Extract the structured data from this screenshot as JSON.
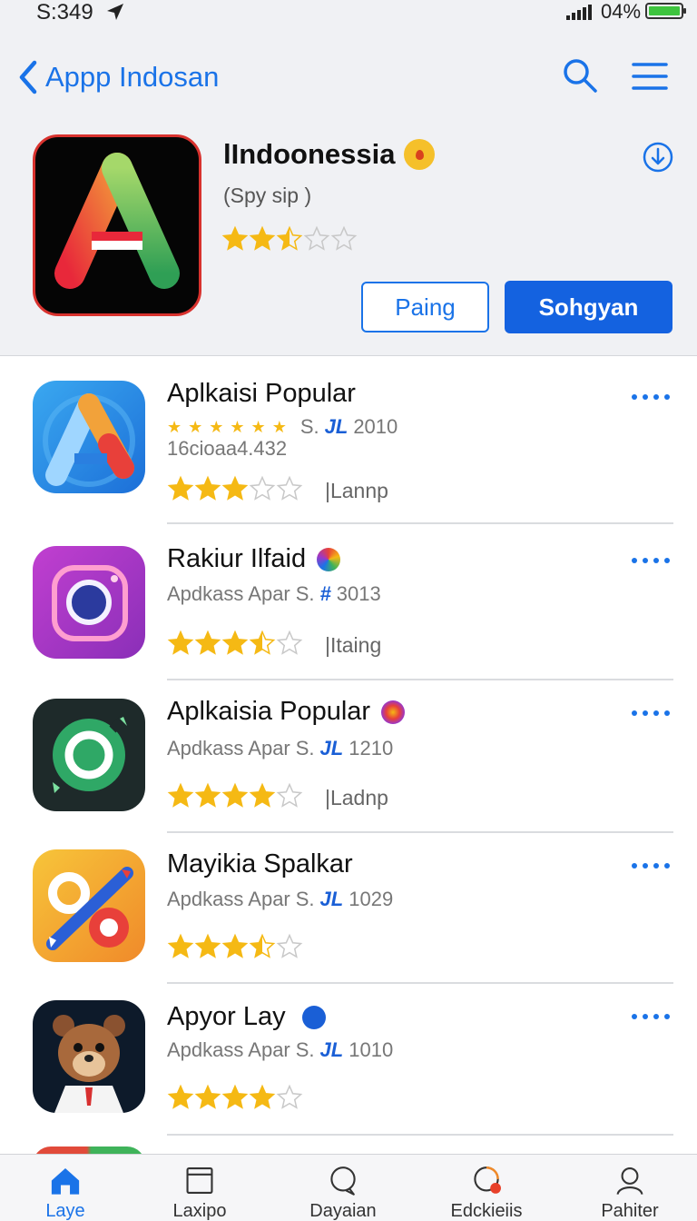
{
  "status_bar": {
    "time": "S:349",
    "battery": "04%"
  },
  "nav": {
    "back_label": "Appp Indosan"
  },
  "hero": {
    "title": "lIndoonessia",
    "subtitle": "(Spy sip )",
    "rating": 2.5,
    "secondary_button": "Paing",
    "primary_button": "Sohgyan"
  },
  "apps": [
    {
      "name": "Aplkaisi Popular",
      "meta_text": "S.",
      "meta_mark": "JL",
      "meta_number": "2010",
      "meta_prefix": "",
      "small_stars": "★ ★ ★ ★ ★ ★",
      "extra_line": "16cioaa4.432",
      "rating": 3,
      "tag": "|Lannp"
    },
    {
      "name": "Rakiur Ilfaid",
      "meta_prefix": "Apdkass Apar",
      "meta_text": "S.",
      "meta_mark": "#",
      "meta_number": "3013",
      "rating": 3.5,
      "tag": "|Itaing"
    },
    {
      "name": "Aplkaisia Popular",
      "meta_prefix": "Apdkass Apar",
      "meta_text": "S.",
      "meta_mark": "JL",
      "meta_number": "1210",
      "rating": 4,
      "tag": "|Ladnp"
    },
    {
      "name": "Mayikia Spalkar",
      "meta_prefix": "Apdkass Apar",
      "meta_text": "S.",
      "meta_mark": "JL",
      "meta_number": "1029",
      "rating": 3.5,
      "tag": ""
    },
    {
      "name": "Apyor Lay",
      "meta_prefix": "Apdkass Apar",
      "meta_text": "S.",
      "meta_mark": "JL",
      "meta_number": "1010",
      "rating": 4,
      "tag": ""
    }
  ],
  "tabs": [
    {
      "label": "Laye",
      "icon": "home-icon",
      "active": true
    },
    {
      "label": "Laxipo",
      "icon": "browser-icon",
      "active": false
    },
    {
      "label": "Dayaian",
      "icon": "chat-icon",
      "active": false
    },
    {
      "label": "Edckieiis",
      "icon": "activity-icon",
      "active": false
    },
    {
      "label": "Pahiter",
      "icon": "profile-icon",
      "active": false
    }
  ],
  "colors": {
    "accent": "#1a73e8",
    "star": "#f5b914",
    "star_empty": "#c8c8c8"
  }
}
